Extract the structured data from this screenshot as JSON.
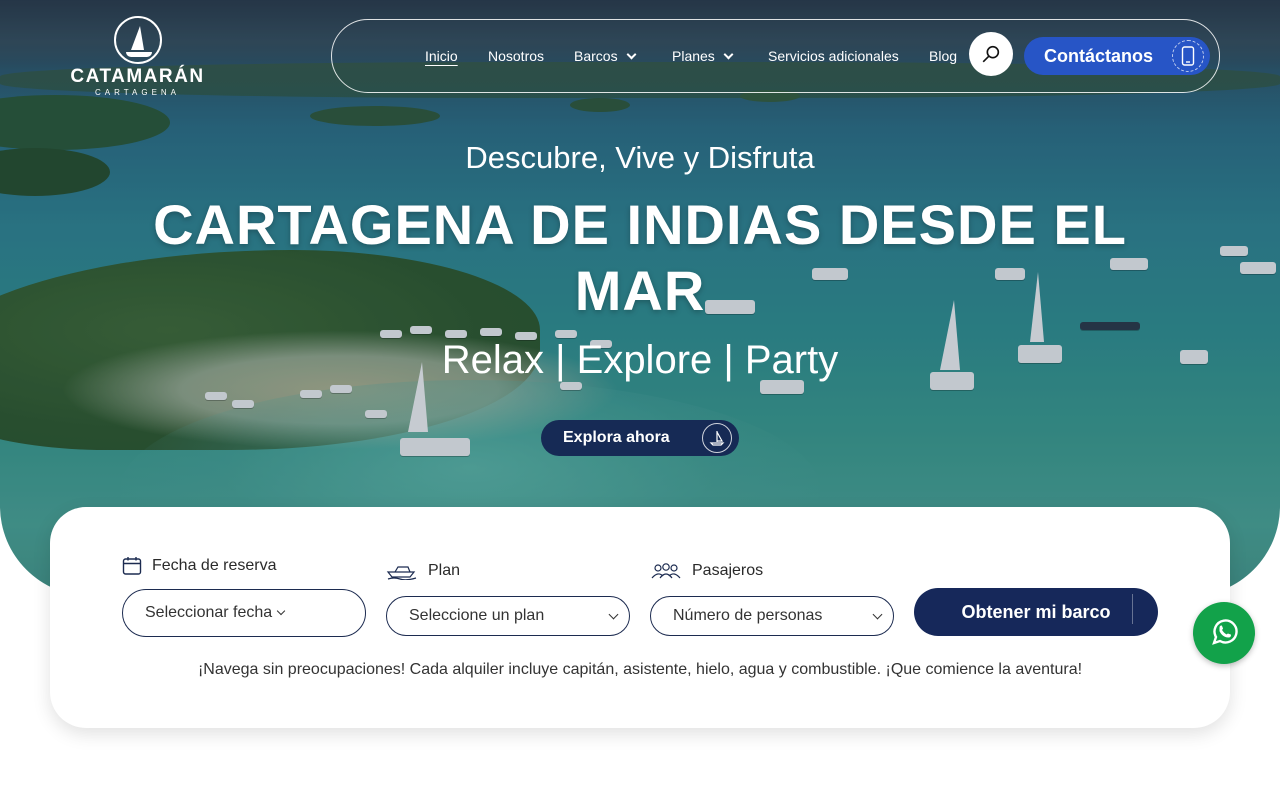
{
  "brand": {
    "name": "CATAMARÁN",
    "subtitle": "CARTAGENA"
  },
  "nav": {
    "items": [
      {
        "label": "Inicio",
        "active": true,
        "dropdown": false
      },
      {
        "label": "Nosotros",
        "active": false,
        "dropdown": false
      },
      {
        "label": "Barcos",
        "active": false,
        "dropdown": true
      },
      {
        "label": "Planes",
        "active": false,
        "dropdown": true
      },
      {
        "label": "Servicios adicionales",
        "active": false,
        "dropdown": false
      },
      {
        "label": "Blog",
        "active": false,
        "dropdown": false
      }
    ],
    "search_icon": "search-icon",
    "contact_label": "Contáctanos",
    "contact_icon": "phone-icon"
  },
  "hero": {
    "tagline": "Descubre, Vive y Disfruta",
    "headline": "CARTAGENA DE INDIAS DESDE EL MAR",
    "subline": "Relax | Explore | Party",
    "cta_label": "Explora ahora",
    "cta_icon": "sailboat-icon"
  },
  "booking": {
    "date": {
      "label": "Fecha de reserva",
      "value": "Seleccionar fecha",
      "icon": "calendar-icon"
    },
    "plan": {
      "label": "Plan",
      "value": "Seleccione un plan",
      "icon": "boat-icon"
    },
    "passengers": {
      "label": "Pasajeros",
      "value": "Número de personas",
      "icon": "people-icon"
    },
    "submit_label": "Obtener mi barco",
    "note": "¡Navega sin preocupaciones! Cada alquiler incluye capitán, asistente, hielo, agua y combustible. ¡Que comience la aventura!"
  },
  "colors": {
    "primary_dark": "#16285a",
    "accent_blue": "#2755c6",
    "whatsapp_green": "#12a24a"
  },
  "whatsapp_icon": "whatsapp-icon"
}
